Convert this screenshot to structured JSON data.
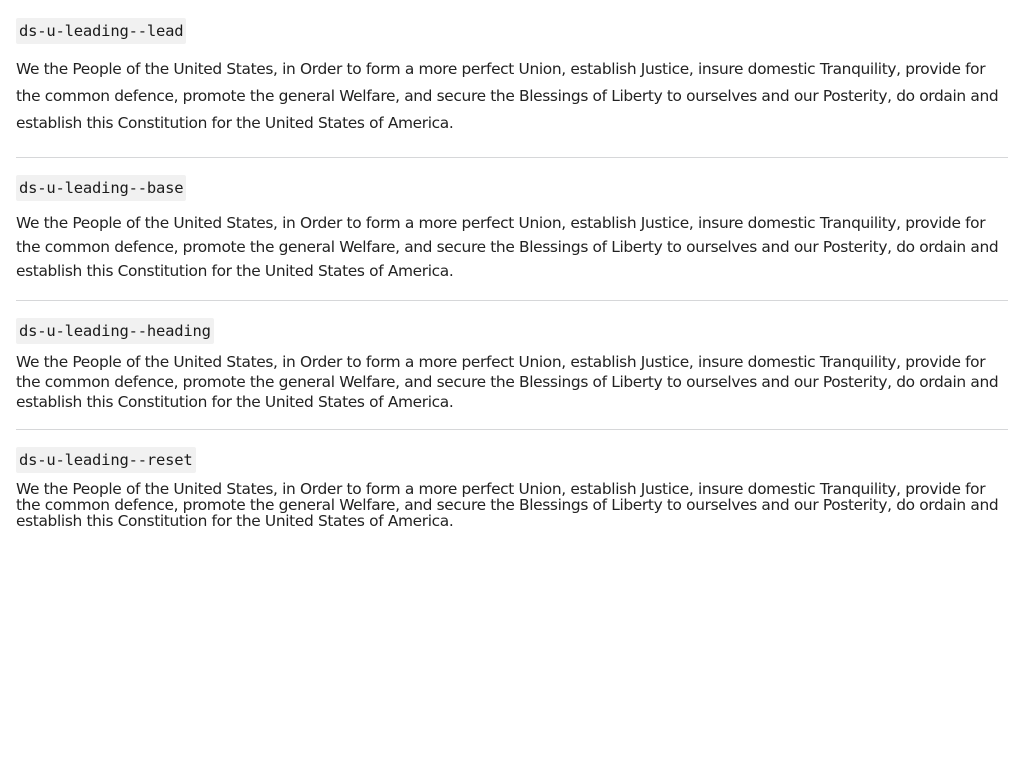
{
  "examples": [
    {
      "class_name": "ds-u-leading--lead",
      "text": "We the People of the United States, in Order to form a more perfect Union, establish Justice, insure domestic Tranquility, provide for the common defence, promote the general Welfare, and secure the Blessings of Liberty to ourselves and our Posterity, do ordain and establish this Constitution for the United States of America."
    },
    {
      "class_name": "ds-u-leading--base",
      "text": "We the People of the United States, in Order to form a more perfect Union, establish Justice, insure domestic Tranquility, provide for the common defence, promote the general Welfare, and secure the Blessings of Liberty to ourselves and our Posterity, do ordain and establish this Constitution for the United States of America."
    },
    {
      "class_name": "ds-u-leading--heading",
      "text": "We the People of the United States, in Order to form a more perfect Union, establish Justice, insure domestic Tranquility, provide for the common defence, promote the general Welfare, and secure the Blessings of Liberty to ourselves and our Posterity, do ordain and establish this Constitution for the United States of America."
    },
    {
      "class_name": "ds-u-leading--reset",
      "text": "We the People of the United States, in Order to form a more perfect Union, establish Justice, insure domestic Tranquility, provide for the common defence, promote the general Welfare, and secure the Blessings of Liberty to ourselves and our Posterity, do ordain and establish this Constitution for the United States of America."
    }
  ]
}
